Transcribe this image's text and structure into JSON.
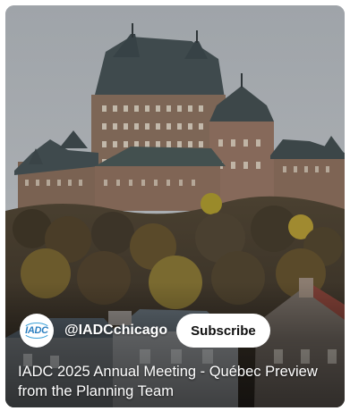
{
  "video": {
    "thumbnail": "chateau-frontenac-autumn-photo",
    "channel": {
      "avatar_text": "IADC",
      "avatar_color": "#2c7fc0",
      "handle": "@IADCchicago"
    },
    "subscribe_label": "Subscribe",
    "title": "IADC 2025 Annual Meeting - Québec Preview from the Planning Team"
  },
  "colors": {
    "sky": "#a7abaf",
    "roof": "#3f4a4d",
    "brick": "#8a6a55",
    "foliage_dark": "#3b3326",
    "foliage_autumn": "#8c7a2a",
    "button_bg": "#ffffff",
    "text": "#ffffff"
  }
}
